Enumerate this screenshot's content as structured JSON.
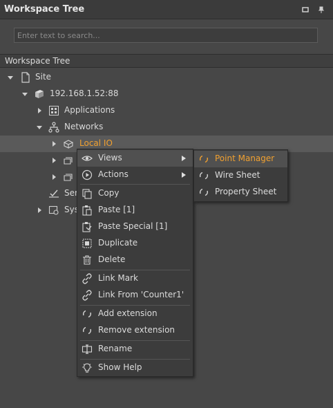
{
  "panel": {
    "title": "Workspace Tree"
  },
  "search": {
    "placeholder": "Enter text to search..."
  },
  "tree_header": {
    "label": "Workspace Tree"
  },
  "tree": {
    "site": "Site",
    "station": "192.168.1.52:88",
    "applications": "Applications",
    "networks": "Networks",
    "local_io": "Local IO",
    "services_partial": "Ser",
    "system_partial": "Sys"
  },
  "context_menu": {
    "views": "Views",
    "actions": "Actions",
    "copy": "Copy",
    "paste": "Paste [1]",
    "paste_special": "Paste Special [1]",
    "duplicate": "Duplicate",
    "delete": "Delete",
    "link_mark": "Link Mark",
    "link_from": "Link From 'Counter1'",
    "add_extension": "Add extension",
    "remove_extension": "Remove extension",
    "rename": "Rename",
    "show_help": "Show Help"
  },
  "views_submenu": {
    "point_manager": "Point Manager",
    "wire_sheet": "Wire Sheet",
    "property_sheet": "Property Sheet"
  },
  "colors": {
    "accent": "#f0a030",
    "background": "#474747",
    "menu": "#3c3c3c"
  }
}
